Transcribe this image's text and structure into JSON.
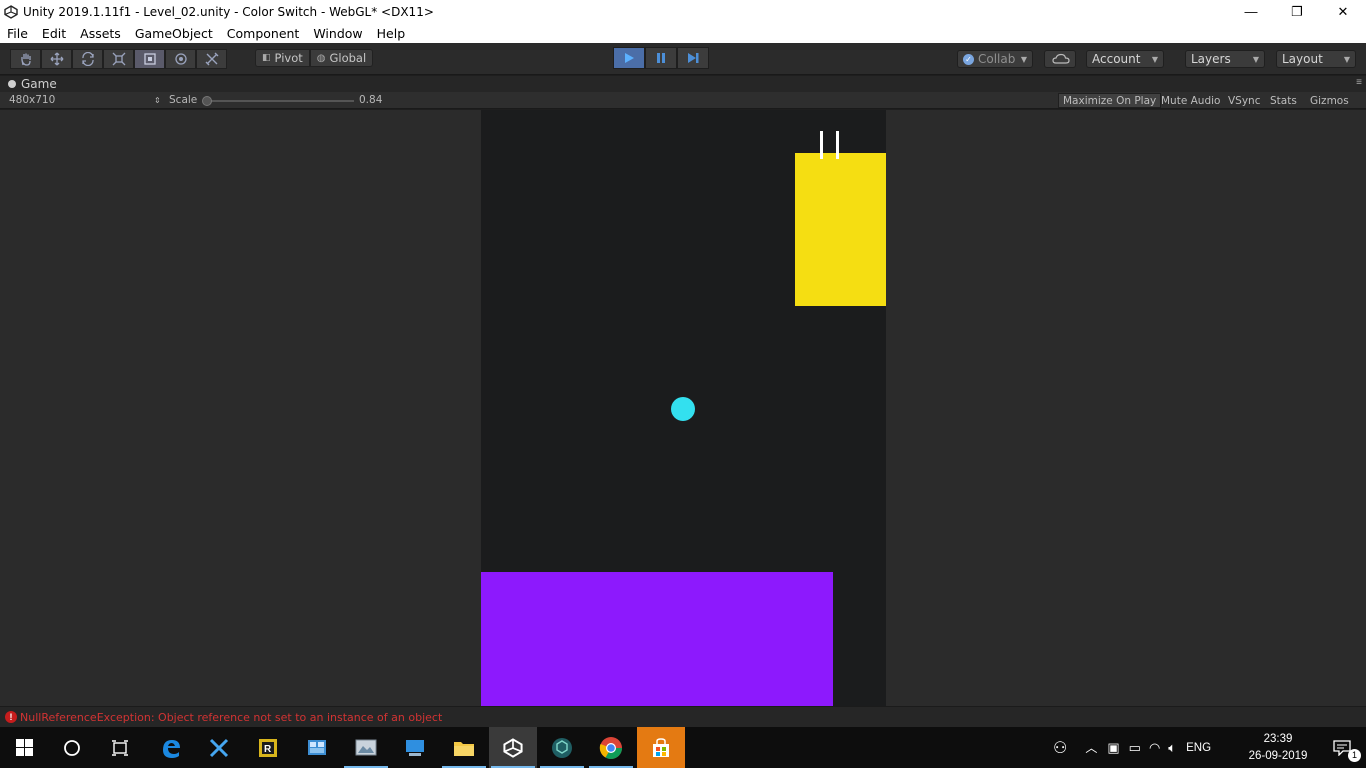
{
  "window": {
    "title": "Unity 2019.1.11f1 - Level_02.unity - Color Switch - WebGL* <DX11>",
    "minimize": "—",
    "restore": "❐",
    "close": "✕"
  },
  "menu": [
    "File",
    "Edit",
    "Assets",
    "GameObject",
    "Component",
    "Window",
    "Help"
  ],
  "toolbar": {
    "pivot_label": "Pivot",
    "global_label": "Global",
    "collab_label": "Collab",
    "account_label": "Account",
    "layers_label": "Layers",
    "layout_label": "Layout"
  },
  "game_tab": {
    "label": "Game",
    "resolution": "480x710",
    "scale_label": "Scale",
    "scale_value": "0.84",
    "maximize_label": "Maximize On Play",
    "mute_label": "Mute Audio",
    "vsync_label": "VSync",
    "stats_label": "Stats",
    "gizmos_label": "Gizmos"
  },
  "game_colors": {
    "background": "#1b1c1d",
    "yellow": "#f5de12",
    "ball": "#33e0ef",
    "purple": "#8d19fd"
  },
  "console": {
    "error_icon": "!",
    "message": "NullReferenceException: Object reference not set to an instance of an object"
  },
  "taskbar": {
    "language": "ENG",
    "time": "23:39",
    "date": "26-09-2019",
    "notification_count": "1"
  }
}
